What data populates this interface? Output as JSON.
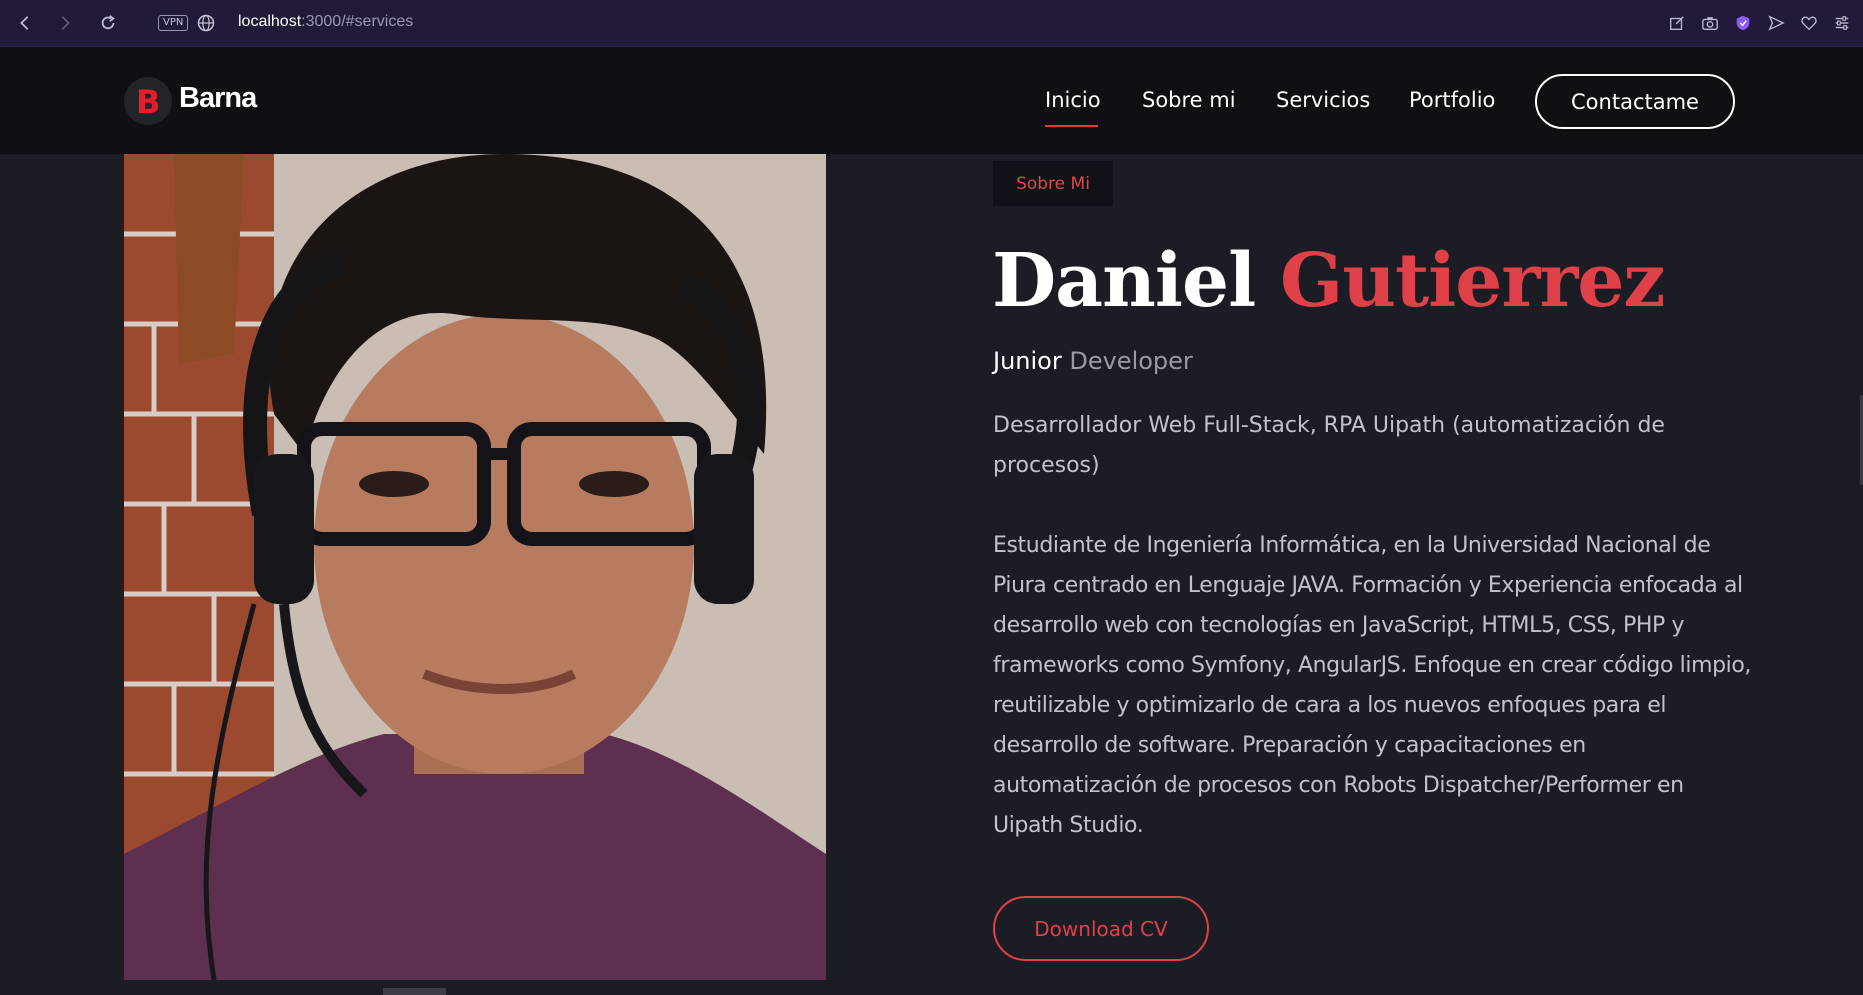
{
  "browser": {
    "url_host": "localhost",
    "url_path": ":3000/#services",
    "vpn_label": "VPN"
  },
  "site": {
    "brand": "Barna",
    "logo_letter": "B",
    "nav": [
      "Inicio",
      "Sobre mi",
      "Servicios",
      "Portfolio"
    ],
    "active_nav": "Inicio",
    "contact_label": "Contactame"
  },
  "about": {
    "tag": "Sobre Mi",
    "first_name": "Daniel",
    "last_name": "Gutierrez",
    "role_first": "Junior",
    "role_second": "Developer",
    "lead": "Desarrollador Web Full-Stack, RPA Uipath (automatización de procesos)",
    "bio": "Estudiante de Ingeniería Informática, en la Universidad Nacional de Piura centrado en Lenguaje JAVA. Formación y Experiencia enfocada al desarrollo web con tecnologías en JavaScript, HTML5, CSS, PHP y frameworks como Symfony, AngularJS. Enfoque en crear código limpio, reutilizable y optimizarlo de cara a los nuevos enfoques para el desarrollo de software. Preparación y capacitaciones en automatización de procesos con Robots Dispatcher/Performer en Uipath Studio.",
    "download_label": "Download CV"
  },
  "colors": {
    "accent": "#e04048",
    "header_bg": "#0f0f14",
    "page_bg": "#1b1c24",
    "browser_bg": "#221a38"
  }
}
